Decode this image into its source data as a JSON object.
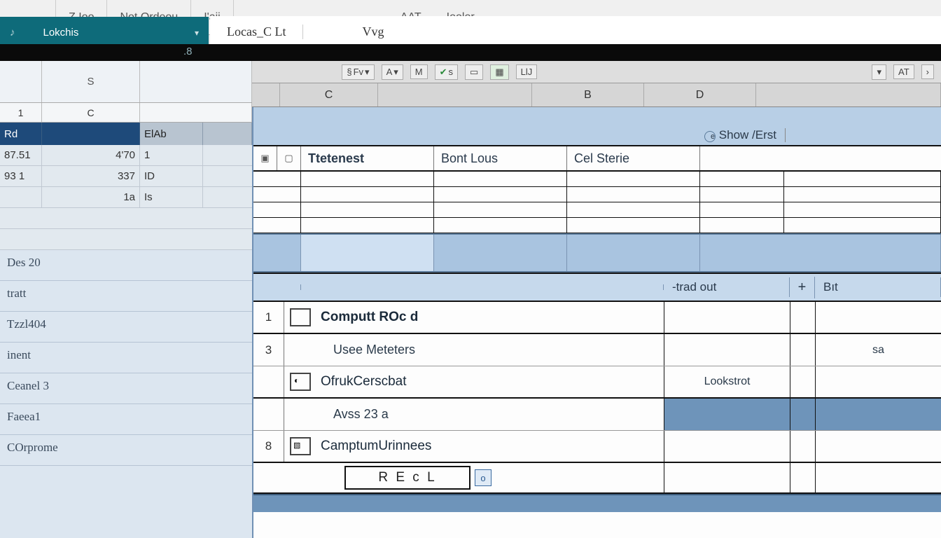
{
  "ribbon": {
    "seg1a": "Z Ioo",
    "seg1b": "Not Ordeou",
    "seg1c": "I'aii",
    "seg_aat": "AAT",
    "seg_loolor": "Ioolor",
    "tab_lokchis": "Lokchis",
    "menu_locas": "Locas_C  Lt",
    "menu_vvg": "Vvg",
    "blacknum": ".8"
  },
  "toolbar": {
    "fv": "Fv",
    "a": "A",
    "m": "M",
    "s": "s",
    "ll": "LlJ",
    "at": "AT",
    "chev": "›"
  },
  "colheads_upper": {
    "c": "C",
    "b": "B",
    "d": "D"
  },
  "leftsheet": {
    "hdr_s": "S",
    "hdr_1": "1",
    "hdr_c": "C",
    "blue1": "Rd",
    "blue2": "ElAb",
    "r1c1": "87.51",
    "r1c2": "4'70",
    "r1c3": "1",
    "r2c1": "93 1",
    "r2c2": "337",
    "r2c3": "ID",
    "r3c2": "1a",
    "r3c3": "Is",
    "ll": [
      "Des 20",
      "tratt",
      "Tzzl404",
      "inent",
      "Ceanel 3",
      "Faeea1",
      "COrprome"
    ]
  },
  "panel": {
    "upperhdr": {
      "c1": "Ttetenest",
      "c2": "Bont Lous",
      "c3": "Cel Sterie",
      "right": "Show /Erst",
      "rchip": "e"
    },
    "mid": {
      "title_num": "1",
      "title": "Computt ROc d",
      "sub_num": "3",
      "sub": "Usee Meteters",
      "row2": "OfrukCerscbat",
      "row2_col": "Lookstrot",
      "row3": "Avss   23 a",
      "row4_num": "8",
      "row4": "CamptumUrinnees",
      "hd_out": "-trad out",
      "hd_but": "Bıt",
      "right_sa": "sa",
      "recl": "R E c L",
      "recl_tag": "o"
    }
  }
}
